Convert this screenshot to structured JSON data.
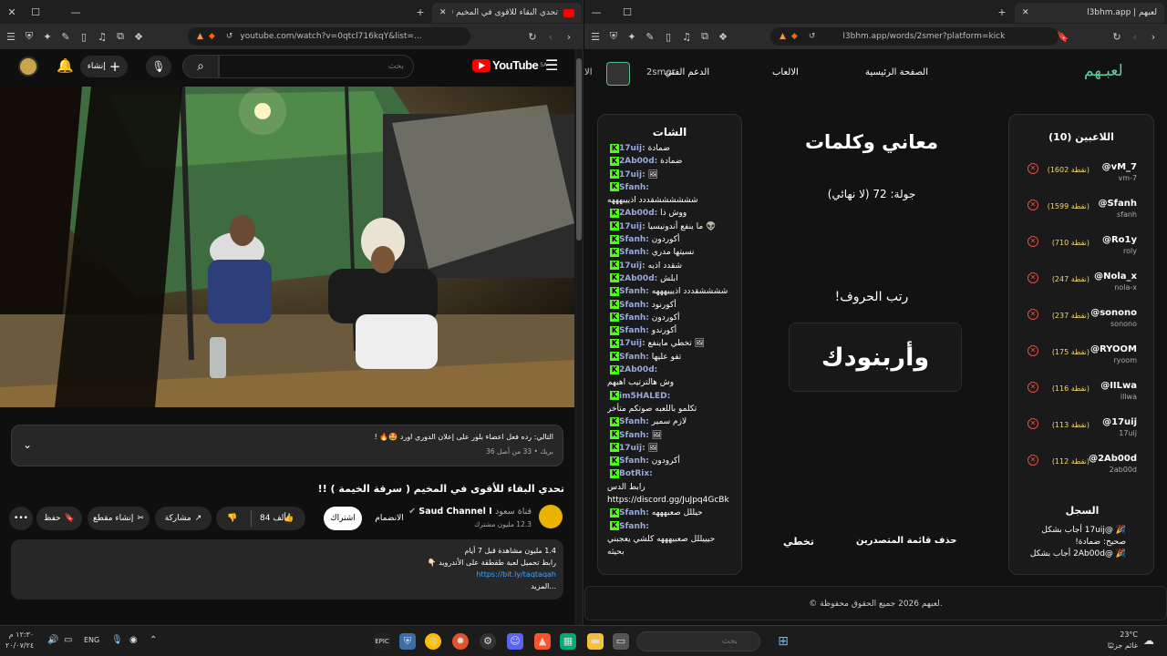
{
  "left": {
    "tab_title": "تحدي البقاء للأقوى في المخيم ( ...",
    "url": "youtube.com/watch?v=0qtcl716kqY&list=...",
    "yt": {
      "logo": "YouTube",
      "logo_sup": "SA",
      "search_placeholder": "بحث",
      "create_label": "إنشاء"
    },
    "pinned": {
      "text": "التالي: رده فعل اعضاء بلور على إعلان الدوري اورد 🤩🔥 !",
      "meta": "بريك • 33 من أصل 36"
    },
    "video_title": "تحدي البقاء للأقوى في المخيم ( سرقة الخيمة ) !!",
    "channel": {
      "name": "Saud Channel I",
      "sub_label": "قناة سعود",
      "subs": "12.3 مليون مشترك",
      "join": "الانضمام",
      "subscribe": "اشتراك"
    },
    "actions": {
      "likes": "84 ألف",
      "share": "مشاركة",
      "clip": "إنشاء مقطع",
      "save": "حفظ"
    },
    "description": {
      "line1": "1.4 مليون مشاهدة  قبل 7 أيام",
      "line2": "رابط تحميل لعبة طقطقة على الأندرويد 👇🏻",
      "link": "https://bit.ly/taqtaqah",
      "more": "...المزيد"
    }
  },
  "right": {
    "tab_title": "لعبهم | l3bhm.app",
    "url": "l3bhm.app/words/2smer?platform=kick",
    "nav": {
      "logo": "لعبـهم",
      "home": "الصفحة الرئيسية",
      "games": "الالعاب",
      "support": "الدعم الفني",
      "user": "2smer",
      "extra": "الا"
    },
    "game": {
      "title": "معاني وكلمات",
      "round": "جولة: 72 (لا نهائي)",
      "prompt": "رتب الحروف!",
      "scrambled": "وأربنودك",
      "skip": "تخطي",
      "clear": "حذف قائمة المتصدرين"
    },
    "players_title": "اللاعبين (10)",
    "players": [
      {
        "name": "@vM_7",
        "sub": "vm-7",
        "pts": "(1602 نقطة)"
      },
      {
        "name": "@Sfanh",
        "sub": "sfanh",
        "pts": "(1599 نقطة)"
      },
      {
        "name": "@Ro1y",
        "sub": "roly",
        "pts": "(710 نقطة)"
      },
      {
        "name": "@Nola_x",
        "sub": "nola-x",
        "pts": "(247 نقطة)"
      },
      {
        "name": "@sonono",
        "sub": "sonono",
        "pts": "(237 نقطة)"
      },
      {
        "name": "@RYOOM",
        "sub": "ryoom",
        "pts": "(175 نقطة)"
      },
      {
        "name": "@IILwa",
        "sub": "illwa",
        "pts": "(116 نقطة)"
      },
      {
        "name": "@17uij",
        "sub": "17uij",
        "pts": "(113 نقطة)"
      },
      {
        "name": "@2Ab00d",
        "sub": "2ab00d",
        "pts": "(112 نقطة)"
      }
    ],
    "log_title": "السجل",
    "log": [
      "🎉 @17uij أجاب بشكل",
      "صحيح: ضمادة!",
      "🎉 @2Ab00d أجاب بشكل"
    ],
    "chat_title": "الشات",
    "chat": [
      {
        "u": "17uij:",
        "m": "ضمادة"
      },
      {
        "u": "2Ab00d:",
        "m": "ضمادة"
      },
      {
        "u": "17uij:",
        "m": "🖼"
      },
      {
        "u": "Sfanh:",
        "m": ""
      },
      {
        "u": "",
        "m": "ششششششقددد اذيييهههه"
      },
      {
        "u": "2Ab00d:",
        "m": "ووش ذا"
      },
      {
        "u": "17uij:",
        "m": "ما ينفع أندونيسيا 👽"
      },
      {
        "u": "Sfanh:",
        "m": "أكوردون"
      },
      {
        "u": "Sfanh:",
        "m": "نسيتها مدري"
      },
      {
        "u": "17uij:",
        "m": "شقدد اذيه"
      },
      {
        "u": "2Ab00d:",
        "m": "ابلش"
      },
      {
        "u": "Sfanh:",
        "m": "ششششقددد اذيييهههه"
      },
      {
        "u": "Sfanh:",
        "m": "أكورنود"
      },
      {
        "u": "Sfanh:",
        "m": "أكوردون"
      },
      {
        "u": "Sfanh:",
        "m": "أكورندو"
      },
      {
        "u": "17uij:",
        "m": "تخطي ماينفع 🖼"
      },
      {
        "u": "Sfanh:",
        "m": "تفو عليها"
      },
      {
        "u": "2Ab00d:",
        "m": ""
      },
      {
        "u": "",
        "m": "وش هالترتيب اهبهم"
      },
      {
        "u": "im5HALED:",
        "m": ""
      },
      {
        "u": "",
        "m": "تكلمو باللعبه صوتكم متأخر"
      },
      {
        "u": "Sfanh:",
        "m": "لازم سمير"
      },
      {
        "u": "Sfanh:",
        "m": "🖼"
      },
      {
        "u": "17uij:",
        "m": "🖼"
      },
      {
        "u": "Sfanh:",
        "m": "أكرودون"
      },
      {
        "u": "BotRix:",
        "m": ""
      },
      {
        "u": "",
        "m": "رابط الدس"
      },
      {
        "u": "",
        "m": "https://discord.gg/JuJpq4GcBk"
      },
      {
        "u": "Sfanh:",
        "m": "حيللل صعبهههه"
      },
      {
        "u": "Sfanh:",
        "m": ""
      },
      {
        "u": "",
        "m": "حيييللل صعبيهههه كلشي يعجبني"
      },
      {
        "u": "",
        "m": "بحيثه"
      }
    ],
    "footer": "© لعبهم 2026 جميع الحقوق محفوظة."
  },
  "taskbar": {
    "time": "١٢:٣٠ م",
    "date": "٢٠/٠٧/٢٤",
    "lang": "ENG",
    "search": "بحث",
    "weather_temp": "23°C",
    "weather_desc": "غائم جزئيًا"
  }
}
